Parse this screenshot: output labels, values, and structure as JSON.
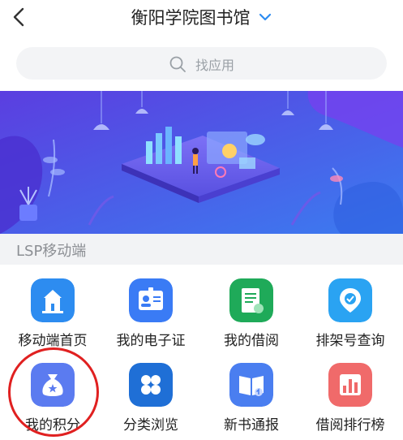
{
  "header": {
    "title": "衡阳学院图书馆"
  },
  "search": {
    "placeholder": "找应用"
  },
  "section": {
    "label": "LSP移动端"
  },
  "apps": [
    {
      "label": "移动端首页",
      "icon": "home-building-icon",
      "color": "#2d8cf0"
    },
    {
      "label": "我的电子证",
      "icon": "id-card-icon",
      "color": "#3a7bf5"
    },
    {
      "label": "我的借阅",
      "icon": "document-icon",
      "color": "#1faa59"
    },
    {
      "label": "排架号查询",
      "icon": "location-pin-icon",
      "color": "#2aa3f2"
    },
    {
      "label": "我的积分",
      "icon": "money-bag-icon",
      "color": "#5b7bf0"
    },
    {
      "label": "分类浏览",
      "icon": "category-grid-icon",
      "color": "#1f6fd6"
    },
    {
      "label": "新书通报",
      "icon": "open-book-icon",
      "color": "#4a7ef0"
    },
    {
      "label": "借阅排行榜",
      "icon": "bar-chart-icon",
      "color": "#f06a6a"
    }
  ],
  "colors": {
    "accent": "#2d8cf0",
    "highlight": "#e02020",
    "banner_start": "#5b3ee0",
    "banner_end": "#3b7cf0"
  }
}
